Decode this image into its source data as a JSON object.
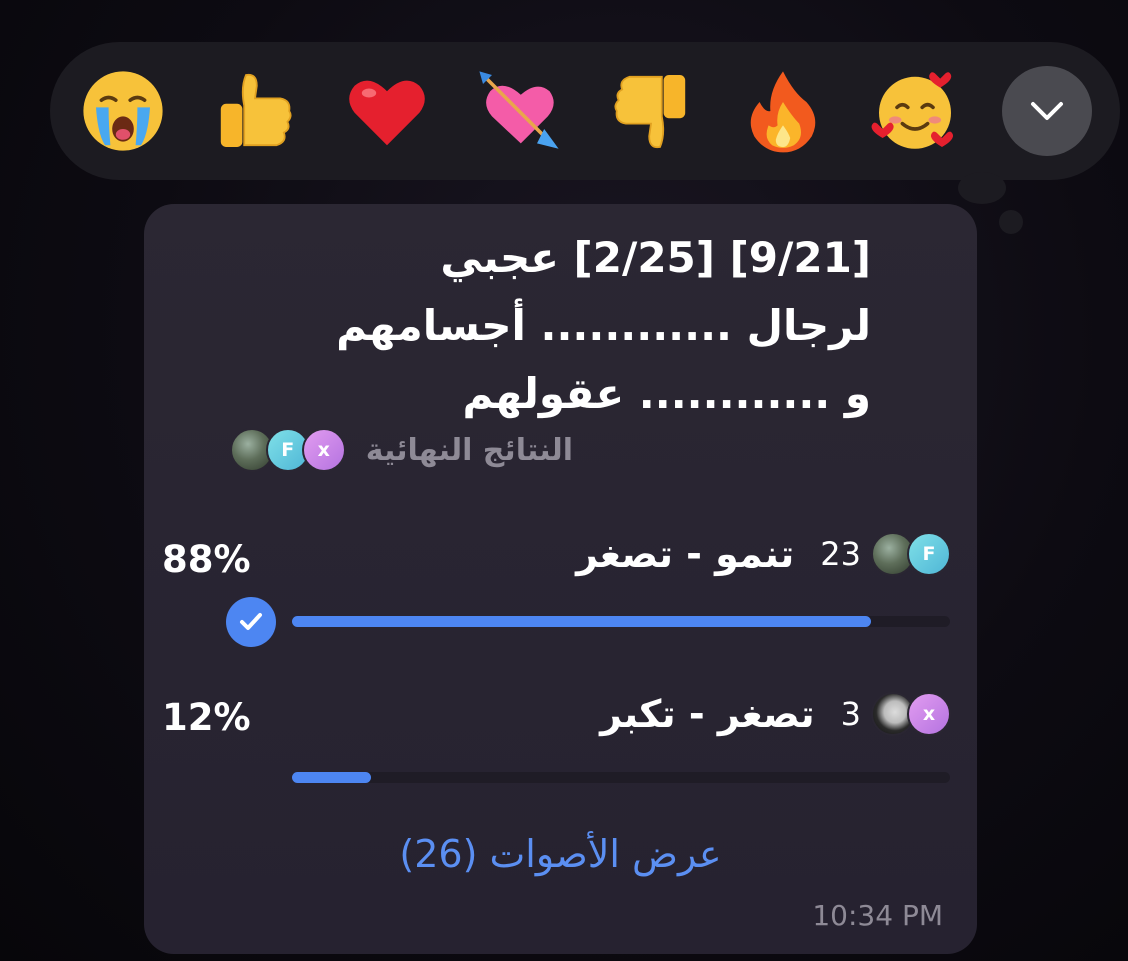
{
  "reactions": [
    {
      "icon": "crying-face-icon"
    },
    {
      "icon": "thumbs-up-icon"
    },
    {
      "icon": "red-heart-icon"
    },
    {
      "icon": "heart-with-arrow-icon"
    },
    {
      "icon": "thumbs-down-icon"
    },
    {
      "icon": "fire-icon"
    },
    {
      "icon": "smiling-face-with-hearts-icon"
    }
  ],
  "expand_icon": "chevron-down-icon",
  "poll": {
    "question_line1": "[9/21] [2/25] عجبي",
    "question_line2": "لرجال ............ أجسامهم",
    "question_line3": "و ............ عقولهم",
    "final_results_label": "النتائج النهائية",
    "voter_avatars": [
      "x",
      "F",
      "photo"
    ],
    "options": [
      {
        "text": "تنمو - تصغر",
        "count": "23",
        "percent_label": "88%",
        "percent": 88,
        "selected": true,
        "avatars": [
          "F",
          "photo"
        ]
      },
      {
        "text": "تصغر - تكبر",
        "count": "3",
        "percent_label": "12%",
        "percent": 12,
        "selected": false,
        "avatars": [
          "x",
          "girl"
        ]
      }
    ],
    "view_votes_label": "عرض الأصوات (26)",
    "timestamp": "10:34 PM"
  },
  "colors": {
    "accent": "#4d86f2",
    "card_bg": "#2a2632",
    "muted_text": "#8e8a96"
  }
}
